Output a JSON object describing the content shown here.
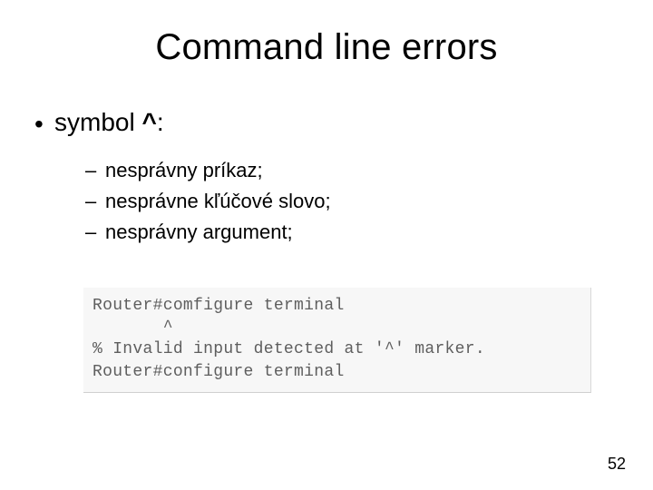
{
  "title": "Command line errors",
  "main_bullet": {
    "prefix": "symbol ",
    "symbol": "^",
    "suffix": ":"
  },
  "sub_bullets": [
    "nesprávny príkaz;",
    "nesprávne kľúčové slovo;",
    "nesprávny argument;"
  ],
  "terminal_lines": [
    "Router#comfigure terminal",
    "       ^",
    "% Invalid input detected at '^' marker.",
    "Router#configure terminal"
  ],
  "page_number": "52"
}
